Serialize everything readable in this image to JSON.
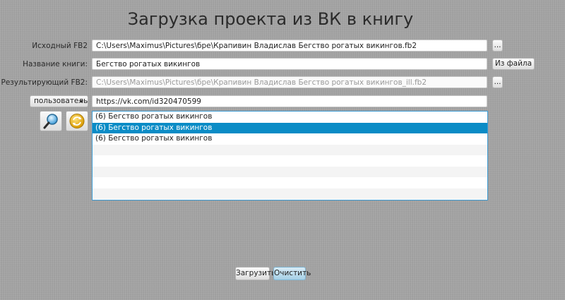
{
  "title": "Загрузка проекта из ВК в книгу",
  "source_fb2": {
    "label": "Исходный FB2",
    "value": "C:\\Users\\Maximus\\Pictures\\бре\\Крапивин Владислав Бегство рогатых викингов.fb2",
    "browse_label": "..."
  },
  "book_name": {
    "label": "Название книги:",
    "value": "Бегство рогатых викингов",
    "from_file_label": "Из файла"
  },
  "result_fb2": {
    "label": "Результирующий FB2:",
    "value": "C:\\Users\\Maximus\\Pictures\\бре\\Крапивин Владислав Бегство рогатых викингов_ill.fb2",
    "browse_label": "..."
  },
  "source_type": {
    "selected": "пользователь"
  },
  "vk_url": {
    "value": "https://vk.com/id320470599"
  },
  "icons": {
    "search": "magnifier-icon",
    "refresh": "refresh-icon"
  },
  "list": {
    "items": [
      "(6) Бегство рогатых викингов",
      "(6) Бегство рогатых викингов",
      "(6) Бегство рогатых викингов"
    ],
    "selected_index": 1,
    "empty_rows": 5
  },
  "actions": {
    "load_label": "Загрузить",
    "clear_label": "Очистить"
  },
  "colors": {
    "selection": "#0a8cc6",
    "focus_border": "#3b9ad2"
  }
}
